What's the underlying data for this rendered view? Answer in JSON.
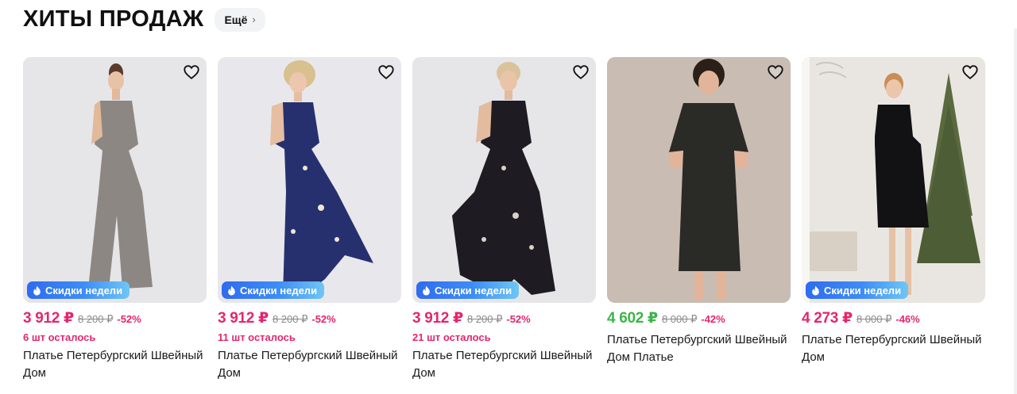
{
  "section": {
    "title": "ХИТЫ ПРОДАЖ",
    "more_label": "Ещё",
    "icons": {
      "more": "chevron-right-icon",
      "favorite": "heart-icon",
      "badge": "fire-icon"
    }
  },
  "products": [
    {
      "price": "3 912 ₽",
      "old_price": "8 200 ₽",
      "discount": "-52%",
      "stock": "6 шт осталось",
      "badge": "Скидки недели",
      "name": "Платье Петербургский Швейный Дом",
      "price_color": "#e3266f",
      "dress_color": "#8d8784",
      "bg_color": "#e6e5e8"
    },
    {
      "price": "3 912 ₽",
      "old_price": "8 200 ₽",
      "discount": "-52%",
      "stock": "11 шт осталось",
      "badge": "Скидки недели",
      "name": "Платье Петербургский Швейный Дом",
      "price_color": "#e3266f",
      "dress_color": "#27306f",
      "bg_color": "#e8e8ec"
    },
    {
      "price": "3 912 ₽",
      "old_price": "8 200 ₽",
      "discount": "-52%",
      "stock": "21 шт осталось",
      "badge": "Скидки недели",
      "name": "Платье Петербургский Швейный Дом",
      "price_color": "#e3266f",
      "dress_color": "#1f1b22",
      "bg_color": "#e6e6e8"
    },
    {
      "price": "4 602 ₽",
      "old_price": "8 000 ₽",
      "discount": "-42%",
      "stock": "",
      "badge": "",
      "name": "Платье Петербургский Швейный Дом Платье",
      "price_color": "#3cb54a",
      "dress_color": "#2a2a27",
      "bg_color": "#c9bcb2"
    },
    {
      "price": "4 273 ₽",
      "old_price": "8 000 ₽",
      "discount": "-46%",
      "stock": "",
      "badge": "Скидки недели",
      "name": "Платье Петербургский Швейный Дом",
      "price_color": "#e3266f",
      "dress_color": "#121214",
      "bg_color": "#e9e6e2"
    }
  ]
}
